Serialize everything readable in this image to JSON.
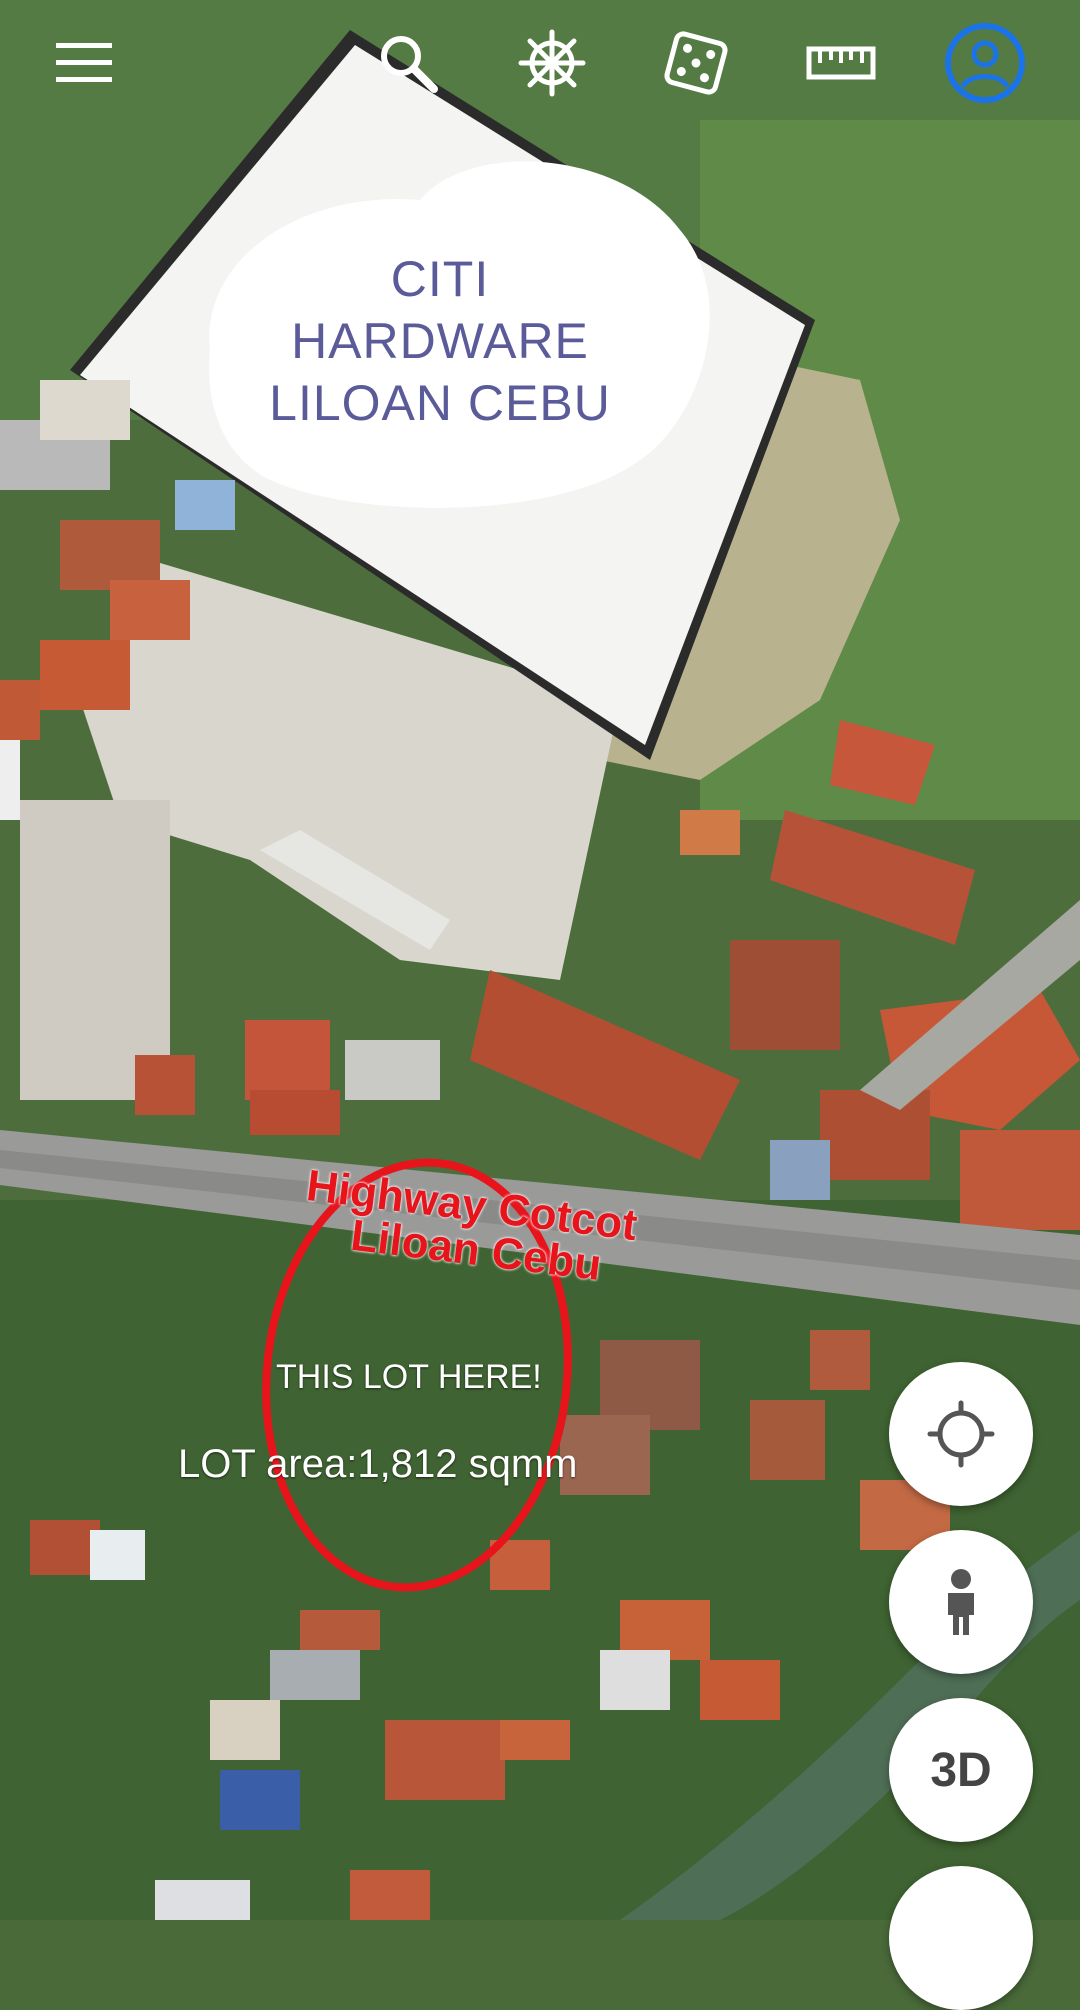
{
  "map": {
    "store_label": [
      "CITI",
      "HARDWARE",
      "LILOAN CEBU"
    ],
    "highway_label": [
      "Highway Cotcot",
      "Liloan Cebu"
    ],
    "lot_caption": "THIS LOT HERE!",
    "lot_area": "LOT area:1,812 sqmm",
    "colors": {
      "annotation_red": "#e8141c",
      "store_label": "#5b5b9a",
      "account_blue": "#1a73e8"
    }
  },
  "toolbar": {
    "icons": [
      "menu-icon",
      "search-icon",
      "voyager-wheel-icon",
      "dice-icon",
      "ruler-icon",
      "account-icon"
    ]
  },
  "controls": {
    "three_d_label": "3D",
    "icons": [
      "my-location-icon",
      "pegman-icon"
    ]
  }
}
